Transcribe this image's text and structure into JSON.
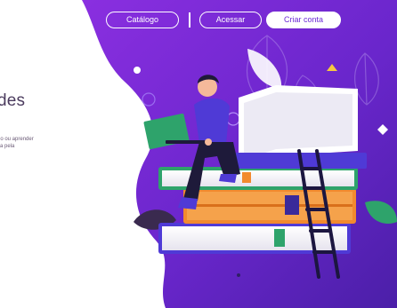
{
  "nav": {
    "catalog_label": "Catálogo",
    "login_label": "Acessar",
    "signup_label": "Criar conta"
  },
  "hero": {
    "heading_fragment": "des",
    "sub_line1": "no ou aprender",
    "sub_line2": "ita pela"
  },
  "colors": {
    "brand_purple": "#6d2bd6",
    "hero_gradient_start": "#7e2fe0",
    "hero_gradient_end": "#4b1fb4"
  }
}
